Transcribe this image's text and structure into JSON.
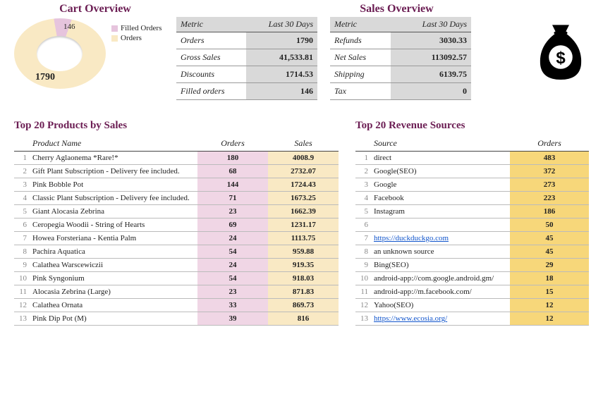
{
  "cart": {
    "title": "Cart Overview",
    "legend": {
      "filled": "Filled Orders",
      "orders": "Orders"
    },
    "big_value": "1790",
    "small_value": "146"
  },
  "sales": {
    "title": "Sales Overview"
  },
  "metrics": {
    "col_metric": "Metric",
    "col_30": "Last 30 Days",
    "left": [
      {
        "label": "Orders",
        "value": "1790"
      },
      {
        "label": "Gross Sales",
        "value": "41,533.81"
      },
      {
        "label": "Discounts",
        "value": "1714.53"
      },
      {
        "label": "Filled orders",
        "value": "146"
      }
    ],
    "right": [
      {
        "label": "Refunds",
        "value": "3030.33"
      },
      {
        "label": "Net Sales",
        "value": "113092.57"
      },
      {
        "label": "Shipping",
        "value": "6139.75"
      },
      {
        "label": "Tax",
        "value": "0"
      }
    ]
  },
  "top_products": {
    "title": "Top 20 Products by Sales",
    "col_name": "Product Name",
    "col_orders": "Orders",
    "col_sales": "Sales",
    "rows": [
      {
        "n": "1",
        "name": "Cherry Aglaonema *Rare!*",
        "orders": "180",
        "sales": "4008.9"
      },
      {
        "n": "2",
        "name": "Gift Plant Subscription - Delivery fee included.",
        "orders": "68",
        "sales": "2732.07"
      },
      {
        "n": "3",
        "name": "Pink Bobble Pot",
        "orders": "144",
        "sales": "1724.43"
      },
      {
        "n": "4",
        "name": "Classic Plant Subscription - Delivery fee included.",
        "orders": "71",
        "sales": "1673.25"
      },
      {
        "n": "5",
        "name": "Giant Alocasia Zebrina",
        "orders": "23",
        "sales": "1662.39"
      },
      {
        "n": "6",
        "name": "Ceropegia Woodii - String of Hearts",
        "orders": "69",
        "sales": "1231.17"
      },
      {
        "n": "7",
        "name": "Howea Forsteriana - Kentia Palm",
        "orders": "24",
        "sales": "1113.75"
      },
      {
        "n": "8",
        "name": "Pachira Aquatica",
        "orders": "54",
        "sales": "959.88"
      },
      {
        "n": "9",
        "name": "Calathea Warscewiczii",
        "orders": "24",
        "sales": "919.35"
      },
      {
        "n": "10",
        "name": "Pink Syngonium",
        "orders": "54",
        "sales": "918.03"
      },
      {
        "n": "11",
        "name": "Alocasia Zebrina (Large)",
        "orders": "23",
        "sales": "871.83"
      },
      {
        "n": "12",
        "name": "Calathea Ornata",
        "orders": "33",
        "sales": "869.73"
      },
      {
        "n": "13",
        "name": "Pink Dip Pot (M)",
        "orders": "39",
        "sales": "816"
      }
    ]
  },
  "top_sources": {
    "title": "Top 20 Revenue Sources",
    "col_source": "Source",
    "col_orders": "Orders",
    "rows": [
      {
        "n": "1",
        "name": "direct",
        "orders": "483",
        "link": false
      },
      {
        "n": "2",
        "name": "Google(SEO)",
        "orders": "372",
        "link": false
      },
      {
        "n": "3",
        "name": "Google",
        "orders": "273",
        "link": false
      },
      {
        "n": "4",
        "name": "Facebook",
        "orders": "223",
        "link": false
      },
      {
        "n": "5",
        "name": "Instagram",
        "orders": "186",
        "link": false
      },
      {
        "n": "6",
        "name": "",
        "orders": "50",
        "link": false
      },
      {
        "n": "7",
        "name": "https://duckduckgo.com",
        "orders": "45",
        "link": true
      },
      {
        "n": "8",
        "name": "an unknown source",
        "orders": "45",
        "link": false
      },
      {
        "n": "9",
        "name": "Bing(SEO)",
        "orders": "29",
        "link": false
      },
      {
        "n": "10",
        "name": "android-app://com.google.android.gm/",
        "orders": "18",
        "link": false
      },
      {
        "n": "11",
        "name": "android-app://m.facebook.com/",
        "orders": "15",
        "link": false
      },
      {
        "n": "12",
        "name": "Yahoo(SEO)",
        "orders": "12",
        "link": false
      },
      {
        "n": "13",
        "name": "https://www.ecosia.org/",
        "orders": "12",
        "link": true
      }
    ]
  },
  "chart_data": {
    "type": "pie",
    "title": "Cart Overview",
    "categories": [
      "Filled Orders",
      "Orders"
    ],
    "values": [
      146,
      1790
    ]
  }
}
